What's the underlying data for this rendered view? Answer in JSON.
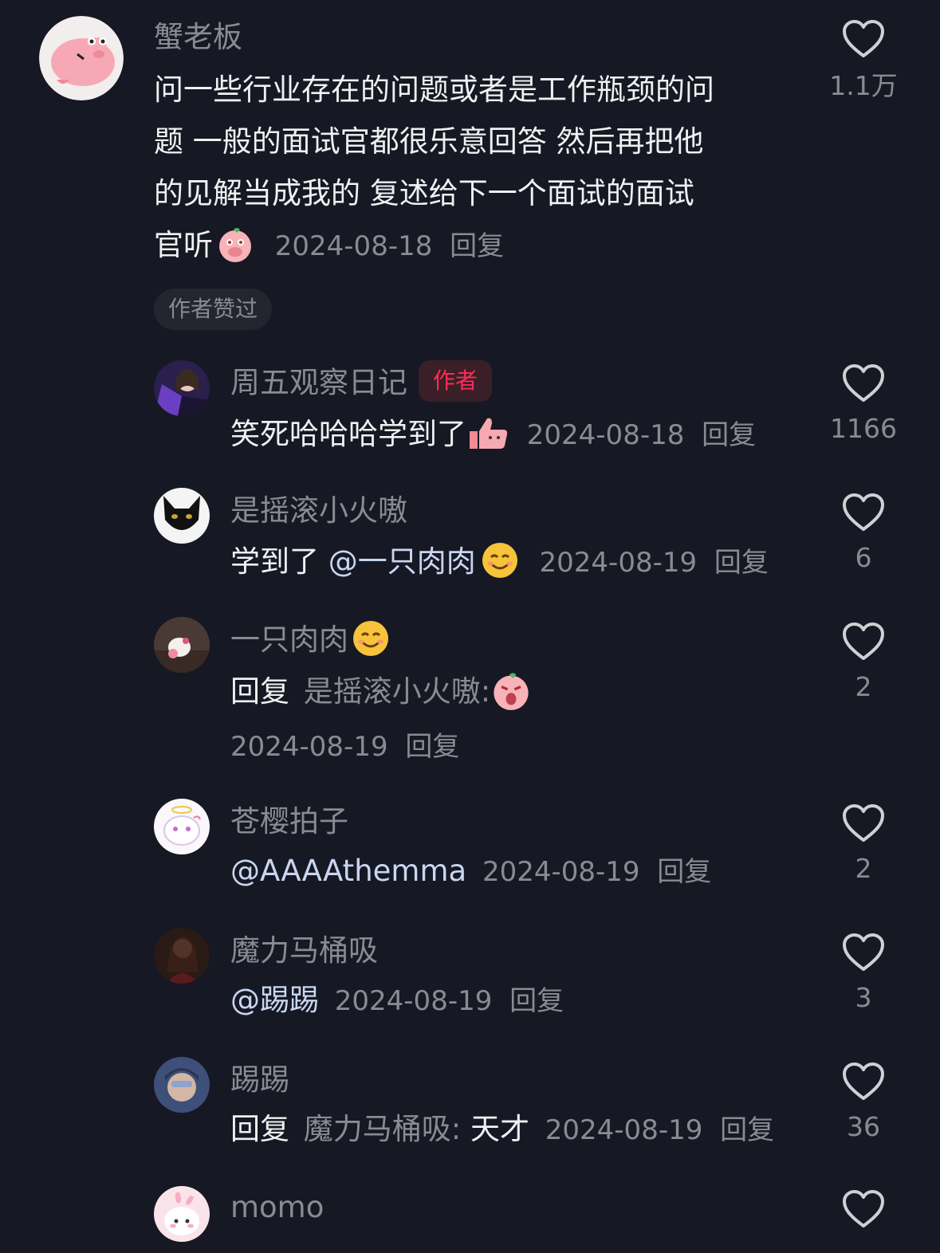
{
  "comments": [
    {
      "name": "蟹老板",
      "text_lines": [
        "问一些行业存在的问题或者是工作瓶颈的问",
        "题  一般的面试官都很乐意回答  然后再把他",
        "的见解当成我的 复述给下一个面试的面试",
        "官听"
      ],
      "date": "2024-08-18",
      "reply_label": "回复",
      "like_count": "1.1万",
      "tag": "作者赞过",
      "avatar_icon": "pink-pig-avatar",
      "emoji_icon": "covering-mouth-emoji"
    }
  ],
  "replies": [
    {
      "name": "周五观察日记",
      "badge": "作者",
      "text": "笑死哈哈哈学到了",
      "emoji_icon": "thumbs-up-emoji",
      "date": "2024-08-18",
      "reply_label": "回复",
      "like_count": "1166",
      "avatar_icon": "purple-portrait-avatar"
    },
    {
      "name": "是摇滚小火嗷",
      "text_prefix": "学到了 ",
      "mention": "@一只肉肉",
      "emoji_icon": "smile-emoji",
      "date": "2024-08-19",
      "reply_label": "回复",
      "like_count": "6",
      "avatar_icon": "black-cat-avatar"
    },
    {
      "name": "一只肉肉",
      "name_emoji_icon": "smile-emoji",
      "reply_word": "回复",
      "reply_to": "是摇滚小火嗷:",
      "emoji_icon": "surprised-pig-emoji",
      "date": "2024-08-19",
      "reply_label": "回复",
      "like_count": "2",
      "avatar_icon": "hello-kitty-avatar"
    },
    {
      "name": "苍樱拍子",
      "mention": "@AAAAthemma",
      "date": "2024-08-19",
      "reply_label": "回复",
      "like_count": "2",
      "avatar_icon": "white-cat-angel-avatar"
    },
    {
      "name": "魔力马桶吸",
      "mention": "@踢踢",
      "date": "2024-08-19",
      "reply_label": "回复",
      "like_count": "3",
      "avatar_icon": "dark-portrait-avatar"
    },
    {
      "name": "踢踢",
      "reply_word": "回复",
      "reply_to": "魔力马桶吸:",
      "text": " 天才",
      "date": "2024-08-19",
      "reply_label": "回复",
      "like_count": "36",
      "avatar_icon": "blue-selfie-avatar"
    },
    {
      "name": "momo",
      "avatar_icon": "pink-bunny-avatar"
    }
  ],
  "colors": {
    "background": "#161823",
    "secondary_text": "#8a8b91",
    "author_badge": "#fe2c55",
    "mention": "#c9d6f0"
  }
}
